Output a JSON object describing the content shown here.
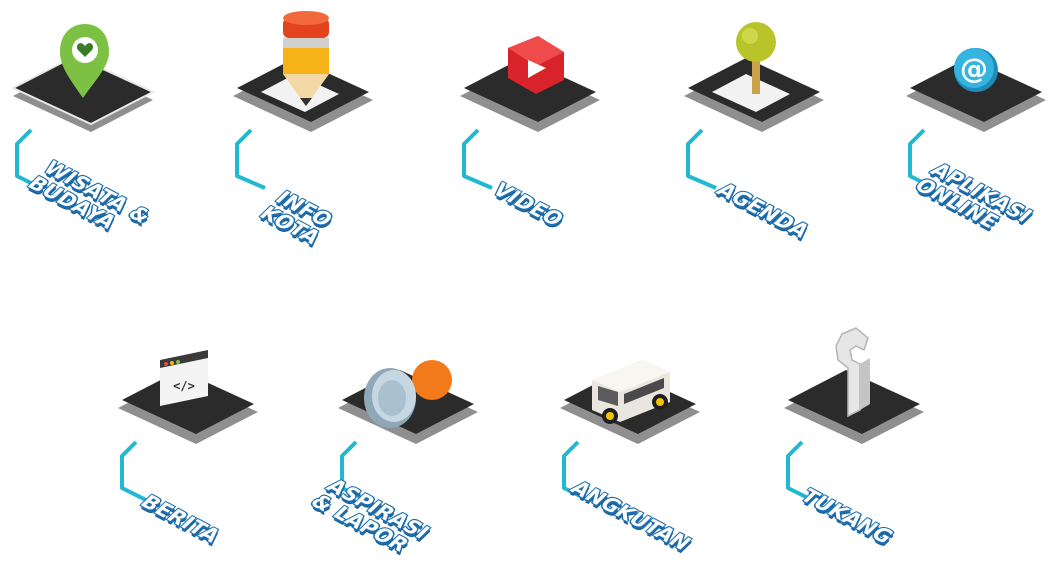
{
  "menu": [
    {
      "id": "wisata",
      "lines": [
        "WISATA &",
        "BUDAYA"
      ],
      "icon": "map-pin-heart-icon"
    },
    {
      "id": "info",
      "lines": [
        "INFO",
        "KOTA"
      ],
      "icon": "pencil-icon"
    },
    {
      "id": "video",
      "lines": [
        "VIDEO"
      ],
      "icon": "play-button-icon"
    },
    {
      "id": "agenda",
      "lines": [
        "AGENDA"
      ],
      "icon": "tree-icon"
    },
    {
      "id": "aplikasi",
      "lines": [
        "APLIKASI",
        "ONLINE"
      ],
      "icon": "at-sign-icon"
    },
    {
      "id": "berita",
      "lines": [
        "BERITA"
      ],
      "icon": "code-window-icon"
    },
    {
      "id": "aspirasi",
      "lines": [
        "ASPIRASI",
        "& LAPOR"
      ],
      "icon": "megaphone-icon"
    },
    {
      "id": "angkutan",
      "lines": [
        "ANGKUTAN"
      ],
      "icon": "van-icon"
    },
    {
      "id": "tukang",
      "lines": [
        "TUKANG"
      ],
      "icon": "wrench-icon"
    }
  ],
  "colors": {
    "tile_top": "#2b2b2b",
    "tile_side": "#8f8f8f",
    "connector": "#22b8d0",
    "label_shadow": "#1d6fb0"
  }
}
